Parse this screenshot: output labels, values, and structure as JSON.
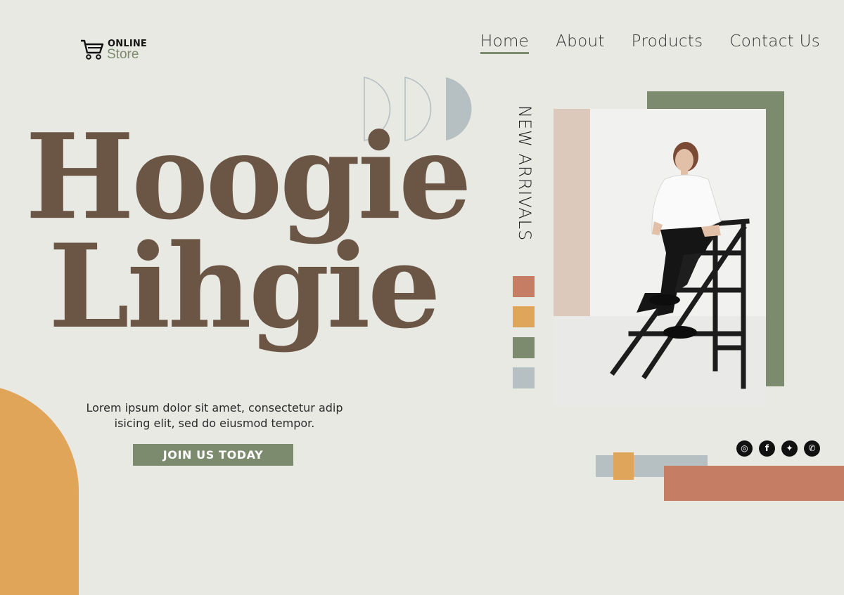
{
  "logo": {
    "line1": "ONLINE",
    "line2": "Store",
    "icon": "shopping-cart-icon"
  },
  "nav": {
    "items": [
      "Home",
      "About",
      "Products",
      "Contact Us"
    ],
    "active": "Home"
  },
  "hero": {
    "headline_line1": "Hoogie",
    "headline_line2": "Lihgie",
    "description": "Lorem ipsum dolor sit amet, consectetur adip isicing elit, sed do eiusmod tempor.",
    "cta_label": "JOIN US TODAY"
  },
  "new_arrivals": {
    "label": "NEW ARRIVALS",
    "swatches": [
      "#c57d63",
      "#dfa55a",
      "#7c8a6d",
      "#b6bfc1"
    ]
  },
  "social": {
    "icons": [
      "instagram-icon",
      "facebook-icon",
      "twitter-icon",
      "whatsapp-icon"
    ]
  },
  "colors": {
    "background": "#e9e9e4",
    "brown": "#6b5646",
    "sage": "#7c8a6d",
    "orange": "#e1a55a",
    "terracotta": "#c57d63",
    "gray_blue": "#b6bfc1"
  }
}
